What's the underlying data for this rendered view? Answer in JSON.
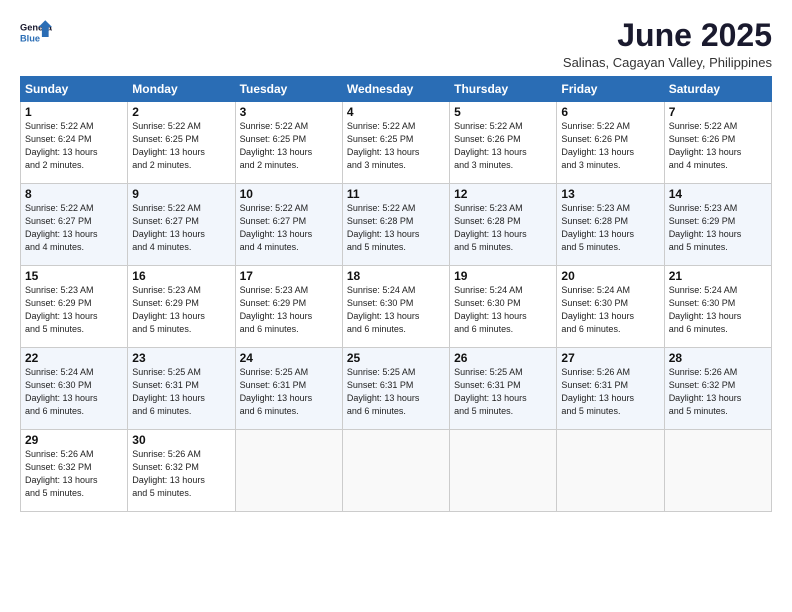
{
  "logo": {
    "line1": "General",
    "line2": "Blue"
  },
  "title": "June 2025",
  "location": "Salinas, Cagayan Valley, Philippines",
  "weekdays": [
    "Sunday",
    "Monday",
    "Tuesday",
    "Wednesday",
    "Thursday",
    "Friday",
    "Saturday"
  ],
  "weeks": [
    [
      {
        "day": "1",
        "info": "Sunrise: 5:22 AM\nSunset: 6:24 PM\nDaylight: 13 hours\nand 2 minutes."
      },
      {
        "day": "2",
        "info": "Sunrise: 5:22 AM\nSunset: 6:25 PM\nDaylight: 13 hours\nand 2 minutes."
      },
      {
        "day": "3",
        "info": "Sunrise: 5:22 AM\nSunset: 6:25 PM\nDaylight: 13 hours\nand 2 minutes."
      },
      {
        "day": "4",
        "info": "Sunrise: 5:22 AM\nSunset: 6:25 PM\nDaylight: 13 hours\nand 3 minutes."
      },
      {
        "day": "5",
        "info": "Sunrise: 5:22 AM\nSunset: 6:26 PM\nDaylight: 13 hours\nand 3 minutes."
      },
      {
        "day": "6",
        "info": "Sunrise: 5:22 AM\nSunset: 6:26 PM\nDaylight: 13 hours\nand 3 minutes."
      },
      {
        "day": "7",
        "info": "Sunrise: 5:22 AM\nSunset: 6:26 PM\nDaylight: 13 hours\nand 4 minutes."
      }
    ],
    [
      {
        "day": "8",
        "info": "Sunrise: 5:22 AM\nSunset: 6:27 PM\nDaylight: 13 hours\nand 4 minutes."
      },
      {
        "day": "9",
        "info": "Sunrise: 5:22 AM\nSunset: 6:27 PM\nDaylight: 13 hours\nand 4 minutes."
      },
      {
        "day": "10",
        "info": "Sunrise: 5:22 AM\nSunset: 6:27 PM\nDaylight: 13 hours\nand 4 minutes."
      },
      {
        "day": "11",
        "info": "Sunrise: 5:22 AM\nSunset: 6:28 PM\nDaylight: 13 hours\nand 5 minutes."
      },
      {
        "day": "12",
        "info": "Sunrise: 5:23 AM\nSunset: 6:28 PM\nDaylight: 13 hours\nand 5 minutes."
      },
      {
        "day": "13",
        "info": "Sunrise: 5:23 AM\nSunset: 6:28 PM\nDaylight: 13 hours\nand 5 minutes."
      },
      {
        "day": "14",
        "info": "Sunrise: 5:23 AM\nSunset: 6:29 PM\nDaylight: 13 hours\nand 5 minutes."
      }
    ],
    [
      {
        "day": "15",
        "info": "Sunrise: 5:23 AM\nSunset: 6:29 PM\nDaylight: 13 hours\nand 5 minutes."
      },
      {
        "day": "16",
        "info": "Sunrise: 5:23 AM\nSunset: 6:29 PM\nDaylight: 13 hours\nand 5 minutes."
      },
      {
        "day": "17",
        "info": "Sunrise: 5:23 AM\nSunset: 6:29 PM\nDaylight: 13 hours\nand 6 minutes."
      },
      {
        "day": "18",
        "info": "Sunrise: 5:24 AM\nSunset: 6:30 PM\nDaylight: 13 hours\nand 6 minutes."
      },
      {
        "day": "19",
        "info": "Sunrise: 5:24 AM\nSunset: 6:30 PM\nDaylight: 13 hours\nand 6 minutes."
      },
      {
        "day": "20",
        "info": "Sunrise: 5:24 AM\nSunset: 6:30 PM\nDaylight: 13 hours\nand 6 minutes."
      },
      {
        "day": "21",
        "info": "Sunrise: 5:24 AM\nSunset: 6:30 PM\nDaylight: 13 hours\nand 6 minutes."
      }
    ],
    [
      {
        "day": "22",
        "info": "Sunrise: 5:24 AM\nSunset: 6:30 PM\nDaylight: 13 hours\nand 6 minutes."
      },
      {
        "day": "23",
        "info": "Sunrise: 5:25 AM\nSunset: 6:31 PM\nDaylight: 13 hours\nand 6 minutes."
      },
      {
        "day": "24",
        "info": "Sunrise: 5:25 AM\nSunset: 6:31 PM\nDaylight: 13 hours\nand 6 minutes."
      },
      {
        "day": "25",
        "info": "Sunrise: 5:25 AM\nSunset: 6:31 PM\nDaylight: 13 hours\nand 6 minutes."
      },
      {
        "day": "26",
        "info": "Sunrise: 5:25 AM\nSunset: 6:31 PM\nDaylight: 13 hours\nand 5 minutes."
      },
      {
        "day": "27",
        "info": "Sunrise: 5:26 AM\nSunset: 6:31 PM\nDaylight: 13 hours\nand 5 minutes."
      },
      {
        "day": "28",
        "info": "Sunrise: 5:26 AM\nSunset: 6:32 PM\nDaylight: 13 hours\nand 5 minutes."
      }
    ],
    [
      {
        "day": "29",
        "info": "Sunrise: 5:26 AM\nSunset: 6:32 PM\nDaylight: 13 hours\nand 5 minutes."
      },
      {
        "day": "30",
        "info": "Sunrise: 5:26 AM\nSunset: 6:32 PM\nDaylight: 13 hours\nand 5 minutes."
      },
      {
        "day": "",
        "info": ""
      },
      {
        "day": "",
        "info": ""
      },
      {
        "day": "",
        "info": ""
      },
      {
        "day": "",
        "info": ""
      },
      {
        "day": "",
        "info": ""
      }
    ]
  ]
}
